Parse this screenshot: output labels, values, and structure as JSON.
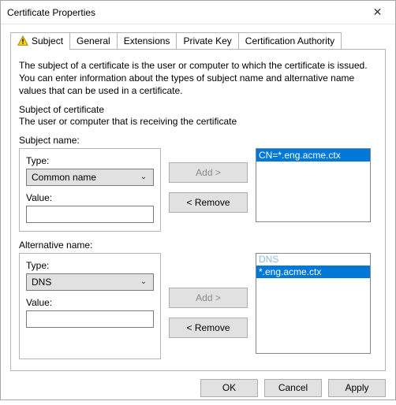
{
  "window": {
    "title": "Certificate Properties"
  },
  "tabs": {
    "subject": "Subject",
    "general": "General",
    "extensions": "Extensions",
    "private_key": "Private Key",
    "cert_authority": "Certification Authority"
  },
  "panel": {
    "desc": "The subject of a certificate is the user or computer to which the certificate is issued. You can enter information about the types of subject name and alternative name values that can be used in a certificate.",
    "sub_heading": "Subject of certificate",
    "sub_line": "The user or computer that is receiving the certificate",
    "subject_name_label": "Subject name:",
    "alt_name_label": "Alternative name:",
    "type_label": "Type:",
    "value_label": "Value:",
    "subject_type": "Common name",
    "subject_value": "",
    "alt_type": "DNS",
    "alt_value": "",
    "add_btn": "Add >",
    "remove_btn": "< Remove",
    "subject_list": [
      "CN=*.eng.acme.ctx"
    ],
    "alt_list_head": "DNS",
    "alt_list": [
      "*.eng.acme.ctx"
    ]
  },
  "buttons": {
    "ok": "OK",
    "cancel": "Cancel",
    "apply": "Apply"
  },
  "icons": {
    "close": "✕",
    "caret": "⌄"
  }
}
